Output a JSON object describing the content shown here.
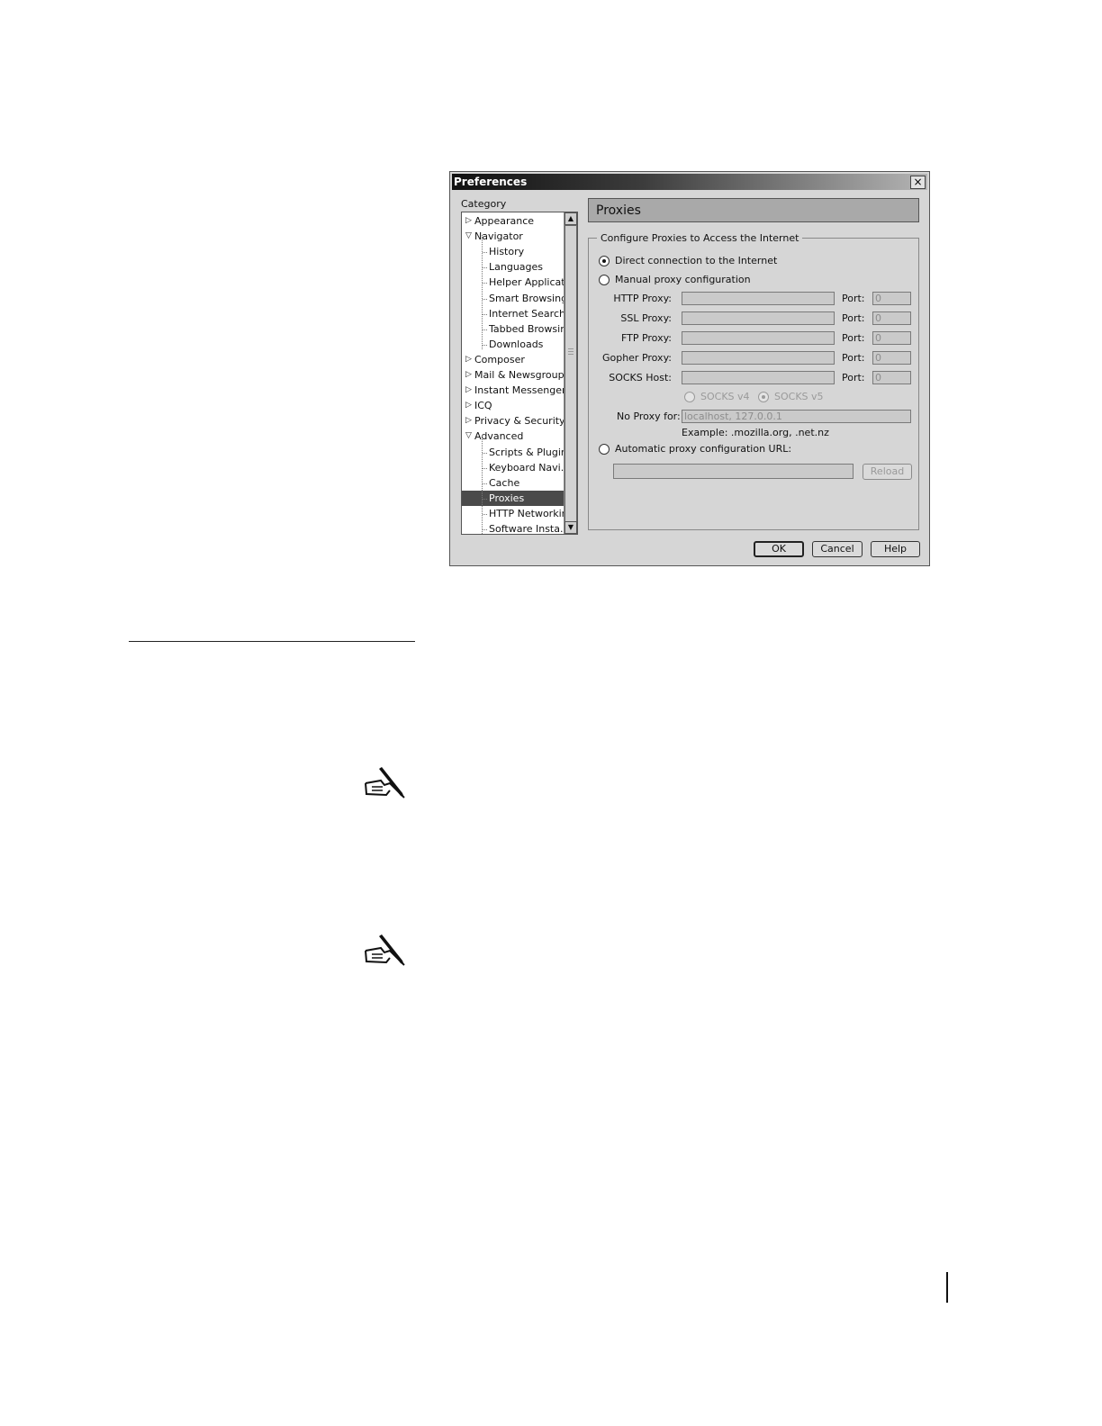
{
  "dialog": {
    "title": "Preferences",
    "close_label": "×",
    "category_label": "Category",
    "tree": [
      {
        "label": "Appearance",
        "level": 0,
        "expanded": false,
        "selected": false
      },
      {
        "label": "Navigator",
        "level": 0,
        "expanded": true,
        "selected": false
      },
      {
        "label": "History",
        "level": 1,
        "selected": false
      },
      {
        "label": "Languages",
        "level": 1,
        "selected": false
      },
      {
        "label": "Helper Applicat...",
        "level": 1,
        "selected": false
      },
      {
        "label": "Smart Browsing",
        "level": 1,
        "selected": false
      },
      {
        "label": "Internet Search",
        "level": 1,
        "selected": false
      },
      {
        "label": "Tabbed Browsing",
        "level": 1,
        "selected": false
      },
      {
        "label": "Downloads",
        "level": 1,
        "selected": false
      },
      {
        "label": "Composer",
        "level": 0,
        "expanded": false,
        "selected": false
      },
      {
        "label": "Mail & Newsgroups",
        "level": 0,
        "expanded": false,
        "selected": false
      },
      {
        "label": "Instant Messenger",
        "level": 0,
        "expanded": false,
        "selected": false
      },
      {
        "label": "ICQ",
        "level": 0,
        "expanded": false,
        "selected": false
      },
      {
        "label": "Privacy & Security",
        "level": 0,
        "expanded": false,
        "selected": false
      },
      {
        "label": "Advanced",
        "level": 0,
        "expanded": true,
        "selected": false
      },
      {
        "label": "Scripts & Plugins",
        "level": 1,
        "selected": false
      },
      {
        "label": "Keyboard Navi...",
        "level": 1,
        "selected": false
      },
      {
        "label": "Cache",
        "level": 1,
        "selected": false
      },
      {
        "label": "Proxies",
        "level": 1,
        "selected": true
      },
      {
        "label": "HTTP Networking",
        "level": 1,
        "selected": false
      },
      {
        "label": "Software Insta...",
        "level": 1,
        "selected": false
      }
    ],
    "panel": {
      "title": "Proxies",
      "group_label": "Configure Proxies to Access the Internet",
      "radio_direct": "Direct connection to the Internet",
      "radio_manual": "Manual proxy configuration",
      "proxies": [
        {
          "label": "HTTP Proxy:",
          "value": "",
          "port_label": "Port:",
          "port": "0"
        },
        {
          "label": "SSL Proxy:",
          "value": "",
          "port_label": "Port:",
          "port": "0"
        },
        {
          "label": "FTP Proxy:",
          "value": "",
          "port_label": "Port:",
          "port": "0"
        },
        {
          "label": "Gopher Proxy:",
          "value": "",
          "port_label": "Port:",
          "port": "0"
        },
        {
          "label": "SOCKS Host:",
          "value": "",
          "port_label": "Port:",
          "port": "0"
        }
      ],
      "socks_v4": "SOCKS v4",
      "socks_v5": "SOCKS v5",
      "no_proxy_label": "No Proxy for:",
      "no_proxy_value": "localhost, 127.0.0.1",
      "example": "Example: .mozilla.org, .net.nz",
      "radio_auto": "Automatic proxy configuration URL:",
      "auto_url_value": "",
      "reload_label": "Reload",
      "selected_mode": "direct"
    },
    "buttons": {
      "ok": "OK",
      "cancel": "Cancel",
      "help": "Help"
    }
  },
  "colors": {
    "title_bar_dark": "#101010",
    "dialog_bg": "#d6d6d6",
    "selection": "#4a4a4a",
    "header_bg": "#a9a9a9"
  },
  "icons": [
    "writing-hand-icon",
    "writing-hand-icon"
  ]
}
